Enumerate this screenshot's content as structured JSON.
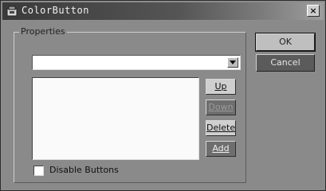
{
  "window": {
    "title": "ColorButton",
    "close_glyph": "×"
  },
  "icons": {
    "app": "app-icon",
    "close": "close-icon",
    "dropdown": "chevron-down-icon"
  },
  "group": {
    "label": "Properties"
  },
  "combo": {
    "value": ""
  },
  "list": {
    "items": []
  },
  "side_buttons": {
    "up": "Up",
    "down": "Down",
    "delete": "Delete",
    "add": "Add"
  },
  "checkbox": {
    "label": "Disable Buttons",
    "checked": false
  },
  "dialog_buttons": {
    "ok": "OK",
    "cancel": "Cancel"
  }
}
